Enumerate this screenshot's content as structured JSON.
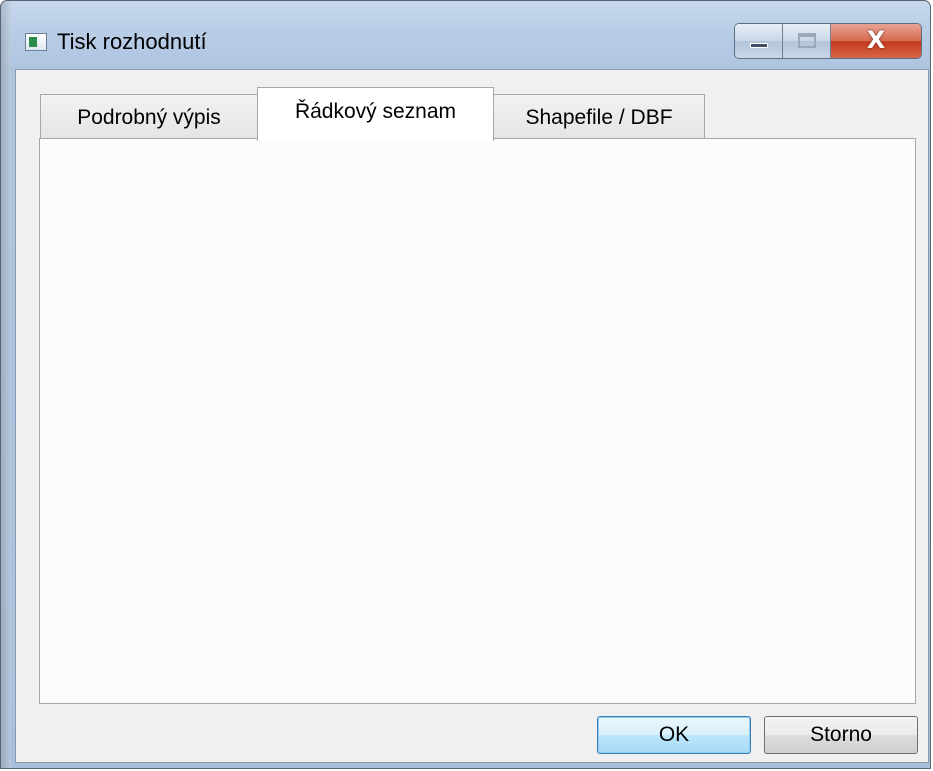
{
  "window": {
    "title": "Tisk rozhodnutí"
  },
  "caption_buttons": {
    "minimize_icon": "minimize-icon",
    "maximize_icon": "maximize-icon",
    "close_icon": "close-icon",
    "close_glyph": "X",
    "close_color": "#c2391b"
  },
  "tabs": [
    {
      "label": "Podrobný výpis",
      "selected": false
    },
    {
      "label": "Řádkový seznam",
      "selected": true
    },
    {
      "label": "Shapefile / DBF",
      "selected": false
    }
  ],
  "buttons": {
    "ok_label": "OK",
    "cancel_label": "Storno"
  },
  "colors": {
    "frame": "#b9cde6",
    "client": "#f0f0f0",
    "default_button_border": "#3c7fb1"
  }
}
